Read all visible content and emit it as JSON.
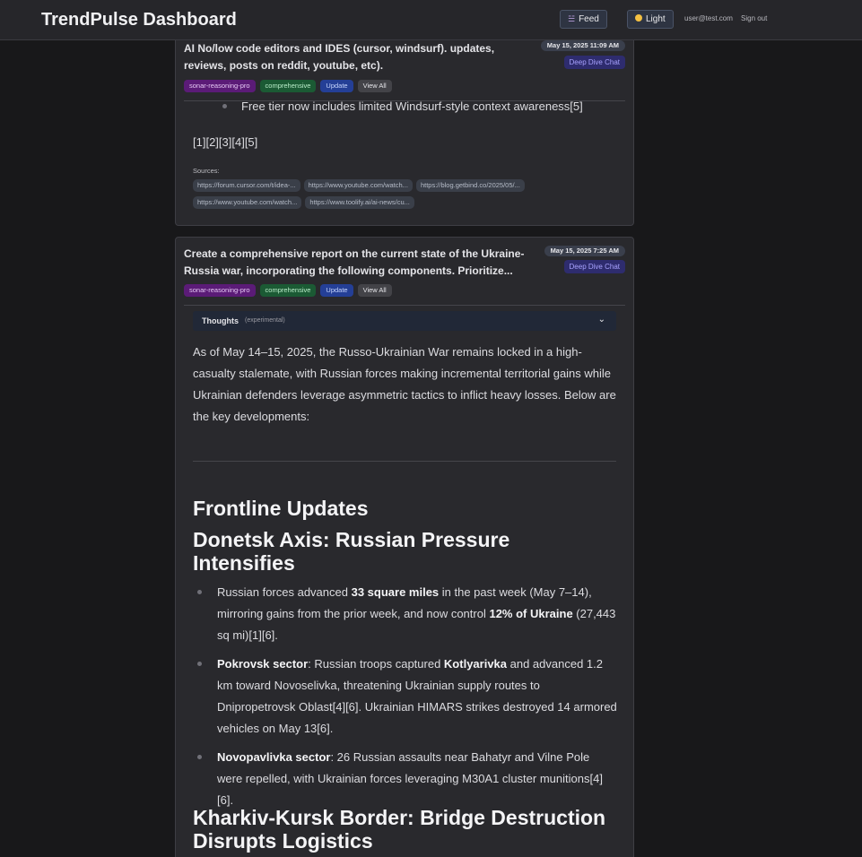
{
  "header": {
    "brand": "TrendPulse Dashboard",
    "feed_label": "Feed",
    "light_label": "Light",
    "user_email": "user@test.com",
    "signout_label": "Sign out"
  },
  "cards": [
    {
      "title": "AI No/low code editors and IDES (cursor, windsurf). updates, reviews, posts on reddit, youtube, etc).",
      "date": "May 15, 2025 11:09 AM",
      "deep_dive_label": "Deep Dive Chat",
      "tags": [
        "sonar-reasoning-pro",
        "comprehensive",
        "Update",
        "View All"
      ],
      "bullet_partial": "Free tier now includes limited Windsurf-style context awareness[5]",
      "citations": "[1][2][3][4][5]",
      "sources_label": "Sources:",
      "sources": [
        "https://forum.cursor.com/t/idea-...",
        "https://www.youtube.com/watch...",
        "https://blog.getbind.co/2025/05/...",
        "https://www.youtube.com/watch...",
        "https://www.toolify.ai/ai-news/cu..."
      ]
    },
    {
      "title": "Create a comprehensive report on the current state of the Ukraine-Russia war, incorporating the following components. Prioritize...",
      "date": "May 15, 2025 7:25 AM",
      "deep_dive_label": "Deep Dive Chat",
      "tags": [
        "sonar-reasoning-pro",
        "comprehensive",
        "Update",
        "View All"
      ],
      "thoughts_label": "Thoughts",
      "thoughts_sub": "(experimental)",
      "intro": "As of May 14–15, 2025, the Russo-Ukrainian War remains locked in a high-casualty stalemate, with Russian forces making incremental territorial gains while Ukrainian defenders leverage asymmetric tactics to inflict heavy losses. Below are the key developments:",
      "section_heading": "Frontline Updates",
      "sub_heading_1": "Donetsk Axis: Russian Pressure Intensifies",
      "bullets": [
        {
          "pre": "Russian forces advanced ",
          "b1": "33 square miles",
          "mid": " in the past week (May 7–14), mirroring gains from the prior week, and now control ",
          "b2": "12% of Ukraine",
          "post": " (27,443 sq mi)[1][6]."
        },
        {
          "b1": "Pokrovsk sector",
          "mid": ": Russian troops captured ",
          "b2": "Kotlyarivka",
          "post": " and advanced 1.2 km toward Novoselivka, threatening Ukrainian supply routes to Dnipropetrovsk Oblast[4][6]. Ukrainian HIMARS strikes destroyed 14 armored vehicles on May 13[6]."
        },
        {
          "b1": "Novopavlivka sector",
          "post": ": 26 Russian assaults near Bahatyr and Vilne Pole were repelled, with Ukrainian forces leveraging M30A1 cluster munitions[4][6]."
        }
      ],
      "sub_heading_2": "Kharkiv-Kursk Border: Bridge Destruction Disrupts Logistics"
    }
  ],
  "colors": {
    "background": "#18181a",
    "card": "#29292d",
    "accent_deep_dive": "#a9a3ff",
    "tag_model": "#5b1b77",
    "tag_depth": "#1b5a34",
    "tag_update": "#243f96"
  }
}
